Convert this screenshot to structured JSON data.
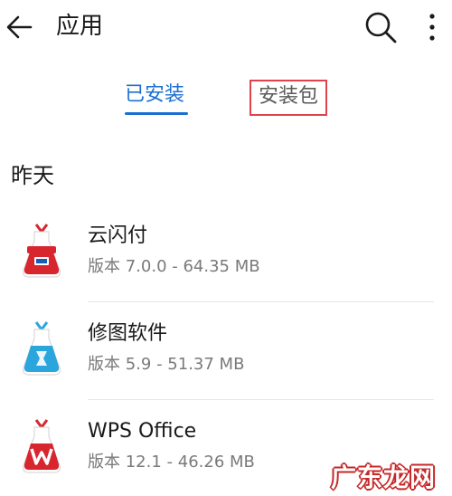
{
  "appbar": {
    "title": "应用",
    "back_icon": "arrow-left-icon",
    "search_icon": "search-icon",
    "more_icon": "more-vertical-icon"
  },
  "tabs": [
    {
      "label": "已安装",
      "selected": true
    },
    {
      "label": "安装包",
      "selected": false,
      "highlighted": true
    }
  ],
  "section": {
    "title": "昨天"
  },
  "apps": [
    {
      "name": "云闪付",
      "meta": "版本 7.0.0 - 64.35 MB",
      "icon": "unionpay-app-icon",
      "color": "#d8262f"
    },
    {
      "name": "修图软件",
      "meta": "版本 5.9 - 51.37 MB",
      "icon": "photo-editor-app-icon",
      "color": "#2aa6dd"
    },
    {
      "name": "WPS Office",
      "meta": "版本 12.1 - 46.26 MB",
      "icon": "wps-office-app-icon",
      "color": "#d8262f"
    }
  ],
  "watermark": {
    "text": "广东龙网"
  },
  "colors": {
    "accent": "#1c6fd1",
    "highlight_box": "#e0434d"
  }
}
